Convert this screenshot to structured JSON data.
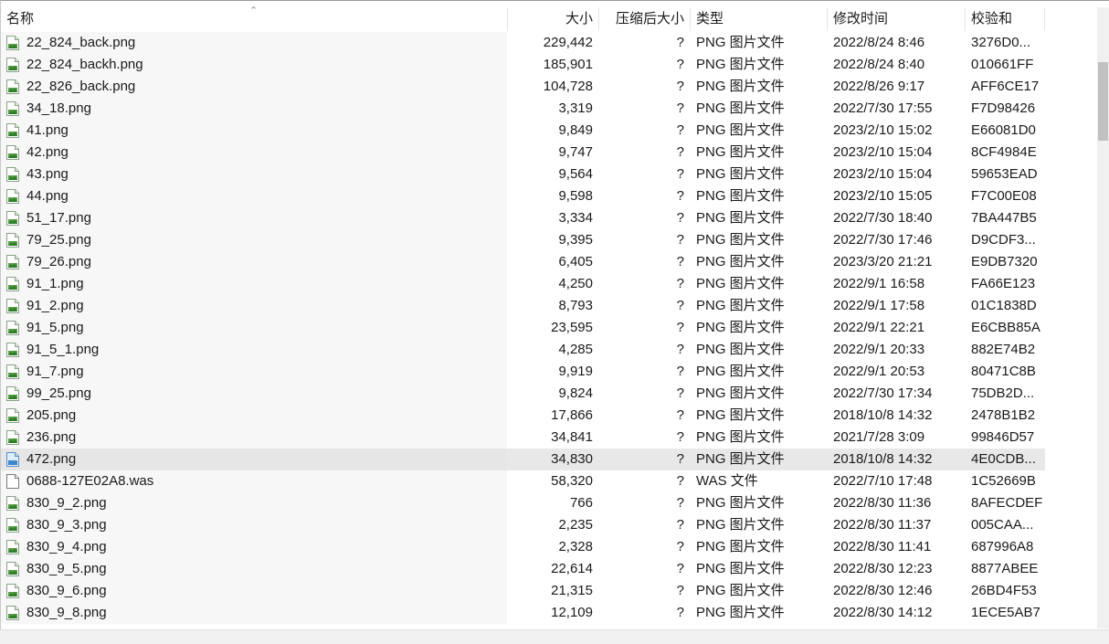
{
  "columns": {
    "name": "名称",
    "size": "大小",
    "packed": "压缩后大小",
    "type": "类型",
    "modified": "修改时间",
    "crc": "校验和"
  },
  "rows": [
    {
      "name": "22_824_back.png",
      "size": "229,442",
      "packed": "?",
      "type": "PNG 图片文件",
      "modified": "2022/8/24 8:46",
      "crc": "3276D0...",
      "icon": "png-file-icon"
    },
    {
      "name": "22_824_backh.png",
      "size": "185,901",
      "packed": "?",
      "type": "PNG 图片文件",
      "modified": "2022/8/24 8:40",
      "crc": "010661FF",
      "icon": "png-file-icon"
    },
    {
      "name": "22_826_back.png",
      "size": "104,728",
      "packed": "?",
      "type": "PNG 图片文件",
      "modified": "2022/8/26 9:17",
      "crc": "AFF6CE17",
      "icon": "png-file-icon"
    },
    {
      "name": "34_18.png",
      "size": "3,319",
      "packed": "?",
      "type": "PNG 图片文件",
      "modified": "2022/7/30 17:55",
      "crc": "F7D98426",
      "icon": "png-file-icon"
    },
    {
      "name": "41.png",
      "size": "9,849",
      "packed": "?",
      "type": "PNG 图片文件",
      "modified": "2023/2/10 15:02",
      "crc": "E66081D0",
      "icon": "png-file-icon"
    },
    {
      "name": "42.png",
      "size": "9,747",
      "packed": "?",
      "type": "PNG 图片文件",
      "modified": "2023/2/10 15:04",
      "crc": "8CF4984E",
      "icon": "png-file-icon"
    },
    {
      "name": "43.png",
      "size": "9,564",
      "packed": "?",
      "type": "PNG 图片文件",
      "modified": "2023/2/10 15:04",
      "crc": "59653EAD",
      "icon": "png-file-icon"
    },
    {
      "name": "44.png",
      "size": "9,598",
      "packed": "?",
      "type": "PNG 图片文件",
      "modified": "2023/2/10 15:05",
      "crc": "F7C00E08",
      "icon": "png-file-icon"
    },
    {
      "name": "51_17.png",
      "size": "3,334",
      "packed": "?",
      "type": "PNG 图片文件",
      "modified": "2022/7/30 18:40",
      "crc": "7BA447B5",
      "icon": "png-file-icon"
    },
    {
      "name": "79_25.png",
      "size": "9,395",
      "packed": "?",
      "type": "PNG 图片文件",
      "modified": "2022/7/30 17:46",
      "crc": "D9CDF3...",
      "icon": "png-file-icon"
    },
    {
      "name": "79_26.png",
      "size": "6,405",
      "packed": "?",
      "type": "PNG 图片文件",
      "modified": "2023/3/20 21:21",
      "crc": "E9DB7320",
      "icon": "png-file-icon"
    },
    {
      "name": "91_1.png",
      "size": "4,250",
      "packed": "?",
      "type": "PNG 图片文件",
      "modified": "2022/9/1 16:58",
      "crc": "FA66E123",
      "icon": "png-file-icon"
    },
    {
      "name": "91_2.png",
      "size": "8,793",
      "packed": "?",
      "type": "PNG 图片文件",
      "modified": "2022/9/1 17:58",
      "crc": "01C1838D",
      "icon": "png-file-icon"
    },
    {
      "name": "91_5.png",
      "size": "23,595",
      "packed": "?",
      "type": "PNG 图片文件",
      "modified": "2022/9/1 22:21",
      "crc": "E6CBB85A",
      "icon": "png-file-icon"
    },
    {
      "name": "91_5_1.png",
      "size": "4,285",
      "packed": "?",
      "type": "PNG 图片文件",
      "modified": "2022/9/1 20:33",
      "crc": "882E74B2",
      "icon": "png-file-icon"
    },
    {
      "name": "91_7.png",
      "size": "9,919",
      "packed": "?",
      "type": "PNG 图片文件",
      "modified": "2022/9/1 20:53",
      "crc": "80471C8B",
      "icon": "png-file-icon"
    },
    {
      "name": "99_25.png",
      "size": "9,824",
      "packed": "?",
      "type": "PNG 图片文件",
      "modified": "2022/7/30 17:34",
      "crc": "75DB2D...",
      "icon": "png-file-icon"
    },
    {
      "name": "205.png",
      "size": "17,866",
      "packed": "?",
      "type": "PNG 图片文件",
      "modified": "2018/10/8 14:32",
      "crc": "2478B1B2",
      "icon": "png-file-icon"
    },
    {
      "name": "236.png",
      "size": "34,841",
      "packed": "?",
      "type": "PNG 图片文件",
      "modified": "2021/7/28 3:09",
      "crc": "99846D57",
      "icon": "png-file-icon"
    },
    {
      "name": "472.png",
      "size": "34,830",
      "packed": "?",
      "type": "PNG 图片文件",
      "modified": "2018/10/8 14:32",
      "crc": "4E0CDB...",
      "icon": "png-file-icon",
      "selected": true
    },
    {
      "name": "0688-127E02A8.was",
      "size": "58,320",
      "packed": "?",
      "type": "WAS 文件",
      "modified": "2022/7/10 17:48",
      "crc": "1C52669B",
      "icon": "blank-file-icon"
    },
    {
      "name": "830_9_2.png",
      "size": "766",
      "packed": "?",
      "type": "PNG 图片文件",
      "modified": "2022/8/30 11:36",
      "crc": "8AFECDEF",
      "icon": "png-file-icon"
    },
    {
      "name": "830_9_3.png",
      "size": "2,235",
      "packed": "?",
      "type": "PNG 图片文件",
      "modified": "2022/8/30 11:37",
      "crc": "005CAA...",
      "icon": "png-file-icon"
    },
    {
      "name": "830_9_4.png",
      "size": "2,328",
      "packed": "?",
      "type": "PNG 图片文件",
      "modified": "2022/8/30 11:41",
      "crc": "687996A8",
      "icon": "png-file-icon"
    },
    {
      "name": "830_9_5.png",
      "size": "22,614",
      "packed": "?",
      "type": "PNG 图片文件",
      "modified": "2022/8/30 12:23",
      "crc": "8877ABEE",
      "icon": "png-file-icon"
    },
    {
      "name": "830_9_6.png",
      "size": "21,315",
      "packed": "?",
      "type": "PNG 图片文件",
      "modified": "2022/8/30 12:46",
      "crc": "26BD4F53",
      "icon": "png-file-icon"
    },
    {
      "name": "830_9_8.png",
      "size": "12,109",
      "packed": "?",
      "type": "PNG 图片文件",
      "modified": "2022/8/30 14:12",
      "crc": "1ECE5AB7",
      "icon": "png-file-icon"
    }
  ],
  "scroll": {
    "vertical_position": 0.09
  }
}
